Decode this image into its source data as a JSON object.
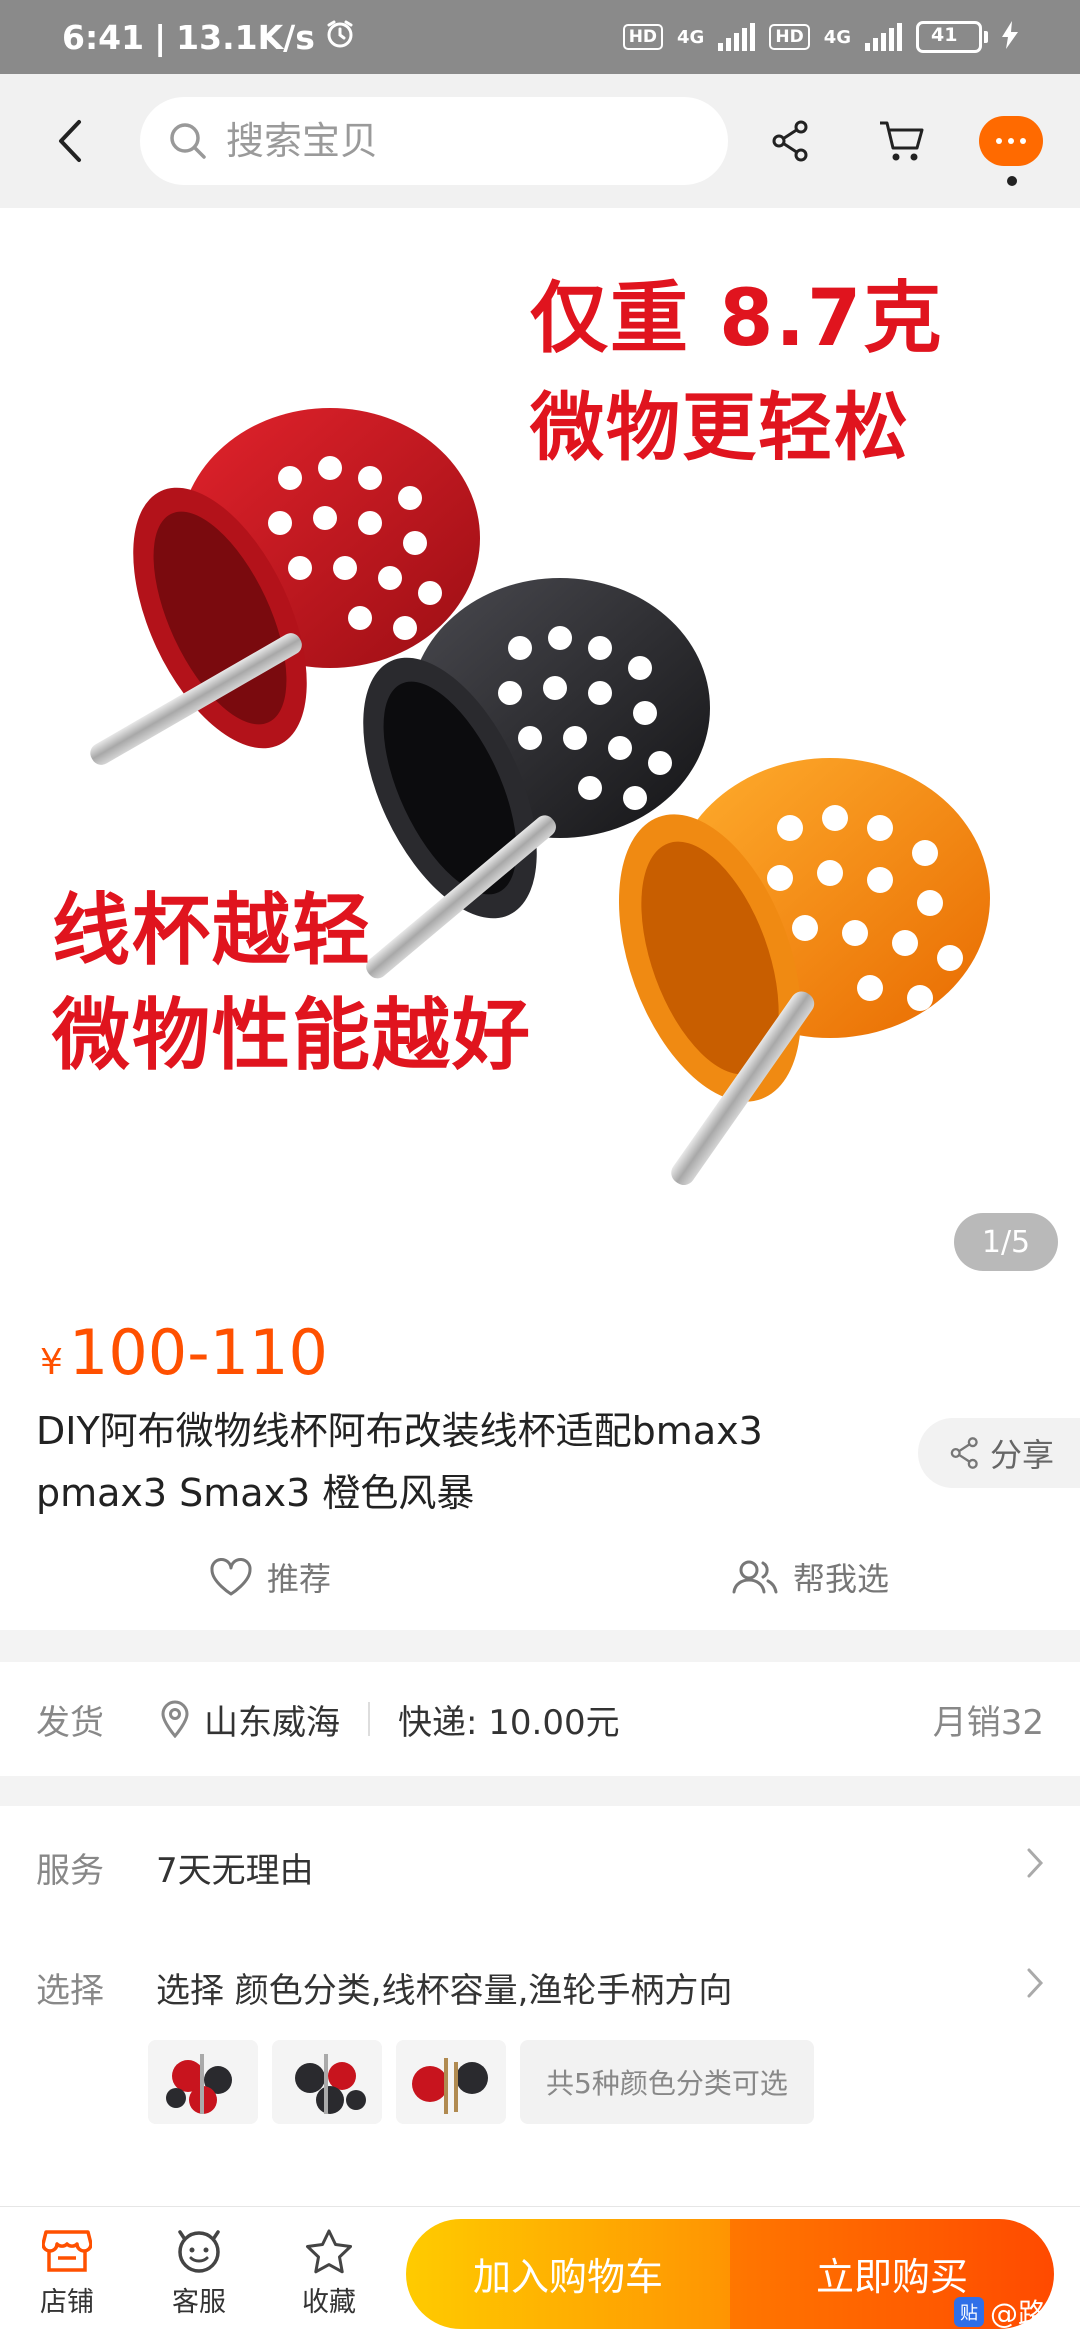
{
  "status_bar": {
    "time": "6:41",
    "speed": "13.1K/s",
    "hd1": "HD",
    "net1": "4G",
    "hd2": "HD",
    "net2": "4G",
    "battery": "41"
  },
  "nav": {
    "search_placeholder": "搜索宝贝"
  },
  "hero": {
    "line1": "仅重 8.7克",
    "line2": "微物更轻松",
    "line3": "线杯越轻",
    "line4": "微物性能越好",
    "pager": "1/5"
  },
  "product": {
    "currency": "¥",
    "price": "100-110",
    "title": "DIY阿布微物线杯阿布改装线杯适配bmax3 pmax3 Smax3 橙色风暴",
    "share_label": "分享",
    "recommend_label": "推荐",
    "help_choose_label": "帮我选"
  },
  "shipping": {
    "label": "发货",
    "location": "山东威海",
    "fee": "快递: 10.00元",
    "monthly_sales": "月销32"
  },
  "service": {
    "label": "服务",
    "value": "7天无理由",
    "select_label": "选择",
    "select_value": "选择 颜色分类,线杯容量,渔轮手柄方向",
    "more_colors": "共5种颜色分类可选"
  },
  "bottom_bar": {
    "store": "店铺",
    "support": "客服",
    "favorite": "收藏",
    "add_to_cart": "加入购物车",
    "buy_now": "立即购买",
    "watermark_badge": "贴",
    "watermark": "@路亚"
  },
  "colors": {
    "accent": "#ff5000",
    "spool_red": "#c8141e",
    "spool_black": "#2a2a2e",
    "spool_orange": "#ff8a10"
  }
}
